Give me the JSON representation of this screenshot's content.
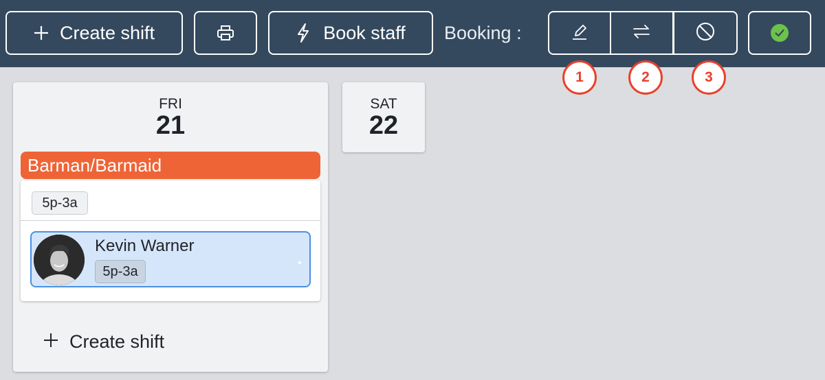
{
  "toolbar": {
    "create_label": "Create shift",
    "book_label": "Book staff",
    "booking_label": "Booking :",
    "markers": [
      "1",
      "2",
      "3"
    ]
  },
  "icons": {
    "create": "plus-icon",
    "print": "printer-icon",
    "book": "lightning-icon",
    "edit": "pencil-icon",
    "swap": "swap-arrows-icon",
    "cancel": "prohibit-icon",
    "confirm": "check-circle-icon"
  },
  "colors": {
    "toolbar_bg": "#34495e",
    "role_bar": "#ef6436",
    "selected_bg": "#d6e6fa",
    "selected_border": "#4a90e2",
    "confirm_green": "#6cc24a",
    "marker_red": "#e8412c"
  },
  "days": [
    {
      "dow": "FRI",
      "num": "21",
      "role": "Barman/Barmaid",
      "shift_time": "5p-3a",
      "staff": {
        "name": "Kevin Warner",
        "time": "5p-3a"
      },
      "add_label": "Create shift"
    },
    {
      "dow": "SAT",
      "num": "22"
    }
  ]
}
